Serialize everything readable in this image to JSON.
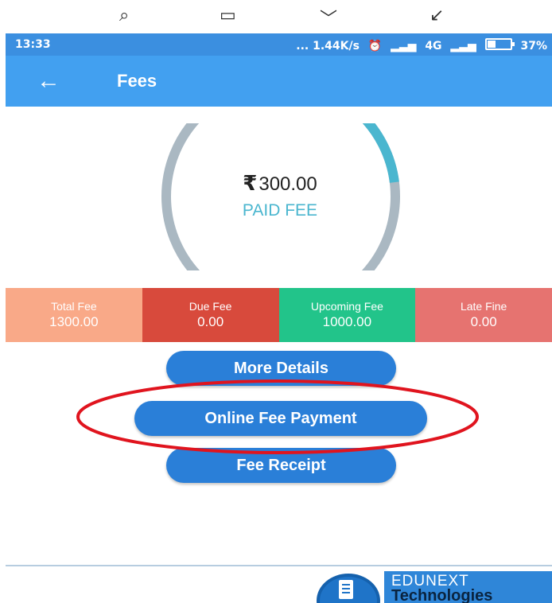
{
  "status_bar": {
    "time": "13:33",
    "speed": "... 1.44K/s",
    "network": "4G",
    "battery": "37%"
  },
  "app_bar": {
    "title": "Fees",
    "back_icon": "arrow-left-icon"
  },
  "summary": {
    "currency_symbol": "₹",
    "paid_amount": "300.00",
    "paid_label": "PAID FEE",
    "paid_fraction": 0.23
  },
  "fee_tiles": [
    {
      "label": "Total Fee",
      "value": "1300.00",
      "color": "#f9a988"
    },
    {
      "label": "Due Fee",
      "value": "0.00",
      "color": "#d84a3c"
    },
    {
      "label": "Upcoming Fee",
      "value": "1000.00",
      "color": "#22c48a"
    },
    {
      "label": "Late Fine",
      "value": "0.00",
      "color": "#e67370"
    }
  ],
  "buttons": {
    "more_details": "More Details",
    "online_payment": "Online Fee Payment",
    "fee_receipt": "Fee Receipt"
  },
  "footer_logo": {
    "line1": "EDUNEXT",
    "line2": "Technologies"
  },
  "colors": {
    "accent": "#42a0f0",
    "button": "#2a7fd8",
    "highlight": "#e0141e",
    "ring_track": "#aab8c2",
    "ring_fill": "#4ab6cf"
  }
}
